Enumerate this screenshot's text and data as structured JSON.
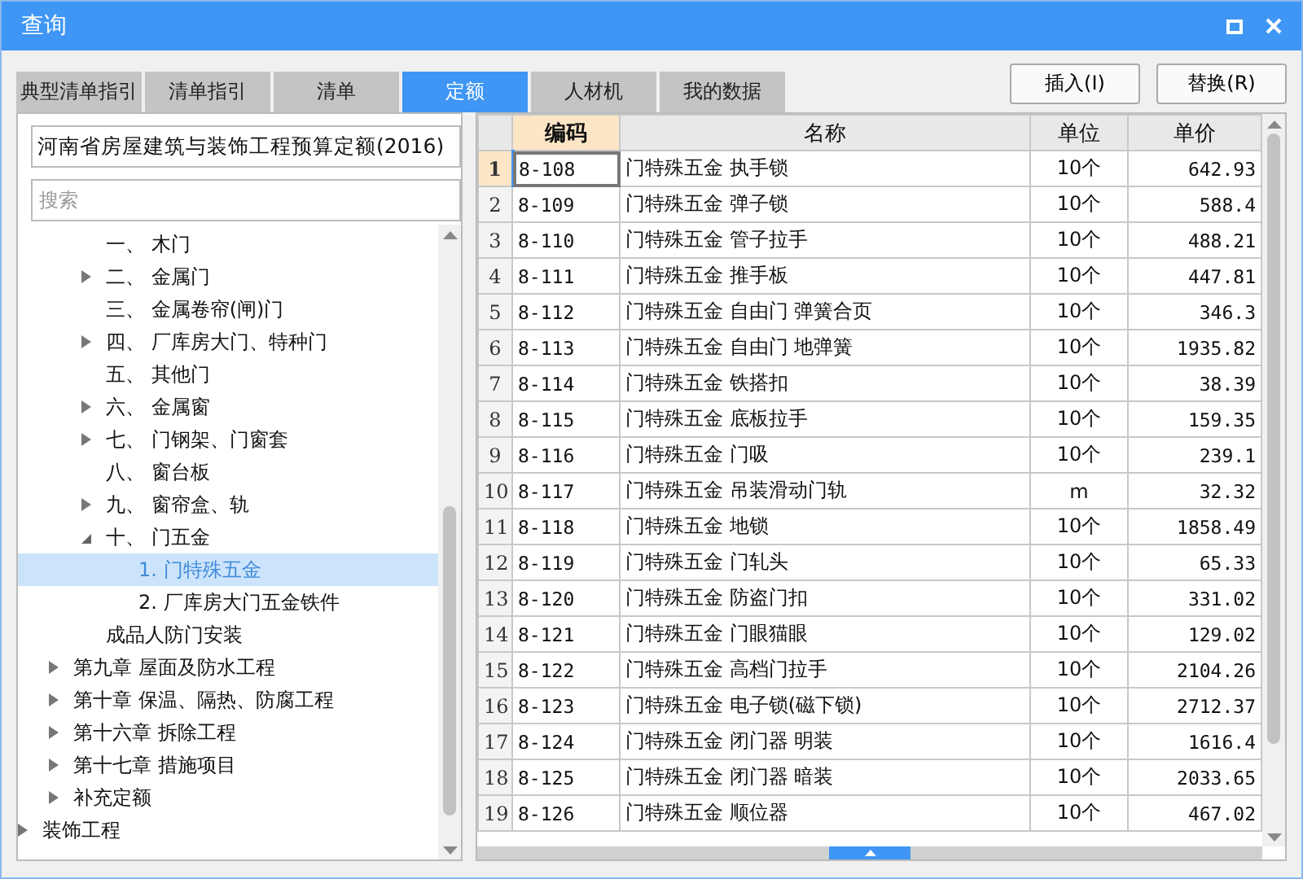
{
  "window": {
    "title": "查询"
  },
  "tabs": [
    {
      "label": "典型清单指引",
      "selected": false
    },
    {
      "label": "清单指引",
      "selected": false
    },
    {
      "label": "清单",
      "selected": false
    },
    {
      "label": "定额",
      "selected": true
    },
    {
      "label": "人材机",
      "selected": false
    },
    {
      "label": "我的数据",
      "selected": false
    }
  ],
  "buttons": [
    "插入(I)",
    "替换(R)"
  ],
  "library_select": {
    "value": "河南省房屋建筑与装饰工程预算定额(2016)"
  },
  "search": {
    "placeholder": "搜索"
  },
  "tree": [
    {
      "children": [
        {
          "children": [
            {
              "label": "一、 木门",
              "expandable": false,
              "selected": false
            },
            {
              "label": "二、 金属门",
              "expandable": true,
              "expanded": false,
              "selected": false
            },
            {
              "label": "三、 金属卷帘(闸)门",
              "expandable": false,
              "selected": false
            },
            {
              "label": "四、 厂库房大门、特种门",
              "expandable": true,
              "expanded": false,
              "selected": false
            },
            {
              "label": "五、 其他门",
              "expandable": false,
              "selected": false
            },
            {
              "label": "六、 金属窗",
              "expandable": true,
              "expanded": false,
              "selected": false
            },
            {
              "label": "七、 门钢架、门窗套",
              "expandable": true,
              "expanded": false,
              "selected": false
            },
            {
              "label": "八、 窗台板",
              "expandable": false,
              "selected": false
            },
            {
              "label": "九、 窗帘盒、轨",
              "expandable": true,
              "expanded": false,
              "selected": false
            },
            {
              "label": "十、 门五金",
              "expandable": true,
              "expanded": true,
              "selected": false,
              "children": [
                {
                  "label": "1. 门特殊五金",
                  "expandable": false,
                  "selected": true
                },
                {
                  "label": "2. 厂库房大门五金铁件",
                  "expandable": false,
                  "selected": false
                }
              ]
            },
            {
              "label": "成品人防门安装",
              "expandable": false,
              "selected": false
            }
          ]
        },
        {
          "label": "第九章 屋面及防水工程",
          "expandable": true,
          "expanded": false,
          "selected": false
        },
        {
          "label": "第十章 保温、隔热、防腐工程",
          "expandable": true,
          "expanded": false,
          "selected": false
        },
        {
          "label": "第十六章 拆除工程",
          "expandable": true,
          "expanded": false,
          "selected": false
        },
        {
          "label": "第十七章 措施项目",
          "expandable": true,
          "expanded": false,
          "selected": false
        },
        {
          "label": "补充定额",
          "expandable": true,
          "expanded": false,
          "selected": false
        }
      ]
    },
    {
      "label": "装饰工程",
      "expandable": true,
      "expanded": false,
      "selected": false
    }
  ],
  "table": {
    "columns": [
      {
        "label": "编码",
        "current": true
      },
      {
        "label": "名称",
        "current": false
      },
      {
        "label": "单位",
        "current": false
      },
      {
        "label": "单价",
        "current": false
      }
    ],
    "rows": [
      {
        "index": "1",
        "selected": true,
        "cells": [
          "8-108",
          "门特殊五金 执手锁",
          "10个",
          "642.93"
        ]
      },
      {
        "index": "2",
        "selected": false,
        "cells": [
          "8-109",
          "门特殊五金 弹子锁",
          "10个",
          "588.4"
        ]
      },
      {
        "index": "3",
        "selected": false,
        "cells": [
          "8-110",
          "门特殊五金 管子拉手",
          "10个",
          "488.21"
        ]
      },
      {
        "index": "4",
        "selected": false,
        "cells": [
          "8-111",
          "门特殊五金 推手板",
          "10个",
          "447.81"
        ]
      },
      {
        "index": "5",
        "selected": false,
        "cells": [
          "8-112",
          "门特殊五金 自由门 弹簧合页",
          "10个",
          "346.3"
        ]
      },
      {
        "index": "6",
        "selected": false,
        "cells": [
          "8-113",
          "门特殊五金 自由门 地弹簧",
          "10个",
          "1935.82"
        ]
      },
      {
        "index": "7",
        "selected": false,
        "cells": [
          "8-114",
          "门特殊五金 铁搭扣",
          "10个",
          "38.39"
        ]
      },
      {
        "index": "8",
        "selected": false,
        "cells": [
          "8-115",
          "门特殊五金 底板拉手",
          "10个",
          "159.35"
        ]
      },
      {
        "index": "9",
        "selected": false,
        "cells": [
          "8-116",
          "门特殊五金 门吸",
          "10个",
          "239.1"
        ]
      },
      {
        "index": "10",
        "selected": false,
        "cells": [
          "8-117",
          "门特殊五金 吊装滑动门轨",
          "m",
          "32.32"
        ]
      },
      {
        "index": "11",
        "selected": false,
        "cells": [
          "8-118",
          "门特殊五金 地锁",
          "10个",
          "1858.49"
        ]
      },
      {
        "index": "12",
        "selected": false,
        "cells": [
          "8-119",
          "门特殊五金 门轧头",
          "10个",
          "65.33"
        ]
      },
      {
        "index": "13",
        "selected": false,
        "cells": [
          "8-120",
          "门特殊五金 防盗门扣",
          "10个",
          "331.02"
        ]
      },
      {
        "index": "14",
        "selected": false,
        "cells": [
          "8-121",
          "门特殊五金 门眼猫眼",
          "10个",
          "129.02"
        ]
      },
      {
        "index": "15",
        "selected": false,
        "cells": [
          "8-122",
          "门特殊五金 高档门拉手",
          "10个",
          "2104.26"
        ]
      },
      {
        "index": "16",
        "selected": false,
        "cells": [
          "8-123",
          "门特殊五金 电子锁(磁下锁)",
          "10个",
          "2712.37"
        ]
      },
      {
        "index": "17",
        "selected": false,
        "cells": [
          "8-124",
          "门特殊五金 闭门器 明装",
          "10个",
          "1616.4"
        ]
      },
      {
        "index": "18",
        "selected": false,
        "cells": [
          "8-125",
          "门特殊五金 闭门器 暗装",
          "10个",
          "2033.65"
        ]
      },
      {
        "index": "19",
        "selected": false,
        "cells": [
          "8-126",
          "门特殊五金 顺位器",
          "10个",
          "467.02"
        ]
      }
    ]
  }
}
